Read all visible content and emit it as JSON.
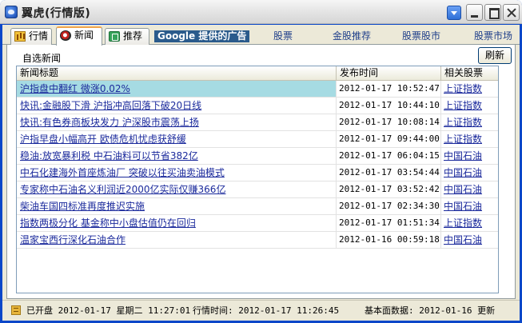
{
  "window": {
    "title": "翼虎(行情版)"
  },
  "tabs": [
    {
      "label": "行情",
      "icon": "chart-icon"
    },
    {
      "label": "新闻",
      "icon": "news-icon",
      "active": true
    },
    {
      "label": "推荐",
      "icon": "recommend-icon"
    }
  ],
  "ads": {
    "label": "Google 提供的广告",
    "links": [
      "股票",
      "金股推荐",
      "股票股市",
      "股票市场"
    ]
  },
  "panel": {
    "section_label": "自选新闻",
    "refresh_label": "刷新"
  },
  "grid": {
    "columns": [
      "新闻标题",
      "发布时间",
      "相关股票"
    ],
    "rows": [
      {
        "title": "沪指盘中翻红 微涨0.02%",
        "time": "2012-01-17 10:52:47",
        "stock": "上证指数",
        "selected": true
      },
      {
        "title": "快讯:金融股下滑 沪指冲高回落下破20日线",
        "time": "2012-01-17 10:44:10",
        "stock": "上证指数"
      },
      {
        "title": "快讯:有色券商板块发力 沪深股市震荡上扬",
        "time": "2012-01-17 10:08:14",
        "stock": "上证指数"
      },
      {
        "title": "沪指早盘小幅高开 欧债危机忧虑获舒缓",
        "time": "2012-01-17 09:44:00",
        "stock": "上证指数"
      },
      {
        "title": "稳油:放宽暴利税 中石油料可以节省382亿",
        "time": "2012-01-17 06:04:15",
        "stock": "中国石油"
      },
      {
        "title": "中石化建海外首座炼油厂 突破以往买油卖油模式",
        "time": "2012-01-17 03:54:44",
        "stock": "中国石油"
      },
      {
        "title": "专家称中石油名义利润近2000亿实际仅赚366亿",
        "time": "2012-01-17 03:52:42",
        "stock": "中国石油"
      },
      {
        "title": "柴油车国四标准再度推迟实施",
        "time": "2012-01-17 02:34:30",
        "stock": "中国石油"
      },
      {
        "title": "指数两极分化 基金称中小盘估值仍在回归",
        "time": "2012-01-17 01:51:34",
        "stock": "上证指数"
      },
      {
        "title": "温家宝西行深化石油合作",
        "time": "2012-01-16 00:59:18",
        "stock": "中国石油"
      }
    ]
  },
  "status": {
    "market_open": "已开盘 2012-01-17 星期二 11:27:01",
    "quote_time": "行情时间: 2012-01-17 11:26:45",
    "basic_data": "基本面数据: 2012-01-16 更新"
  }
}
